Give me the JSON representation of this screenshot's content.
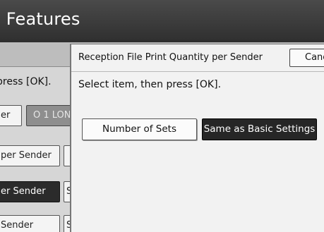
{
  "header": {
    "title": "e Features"
  },
  "background": {
    "instruction": "press [OK].",
    "buttons": [
      {
        "label": "er"
      },
      {
        "label": "O 1 LON"
      },
      {
        "label": "per Sender"
      },
      {
        "label": ""
      },
      {
        "label": "er Sender"
      },
      {
        "label": "S"
      },
      {
        "label": "Sender"
      },
      {
        "label": "S"
      }
    ]
  },
  "dialog": {
    "title": "Reception File Print Quantity per Sender",
    "cancel_label": "Cancel",
    "instruction": "Select item, then press [OK].",
    "options": [
      {
        "label": "Number of Sets",
        "selected": false
      },
      {
        "label": "Same as Basic Settings",
        "selected": true
      }
    ]
  }
}
